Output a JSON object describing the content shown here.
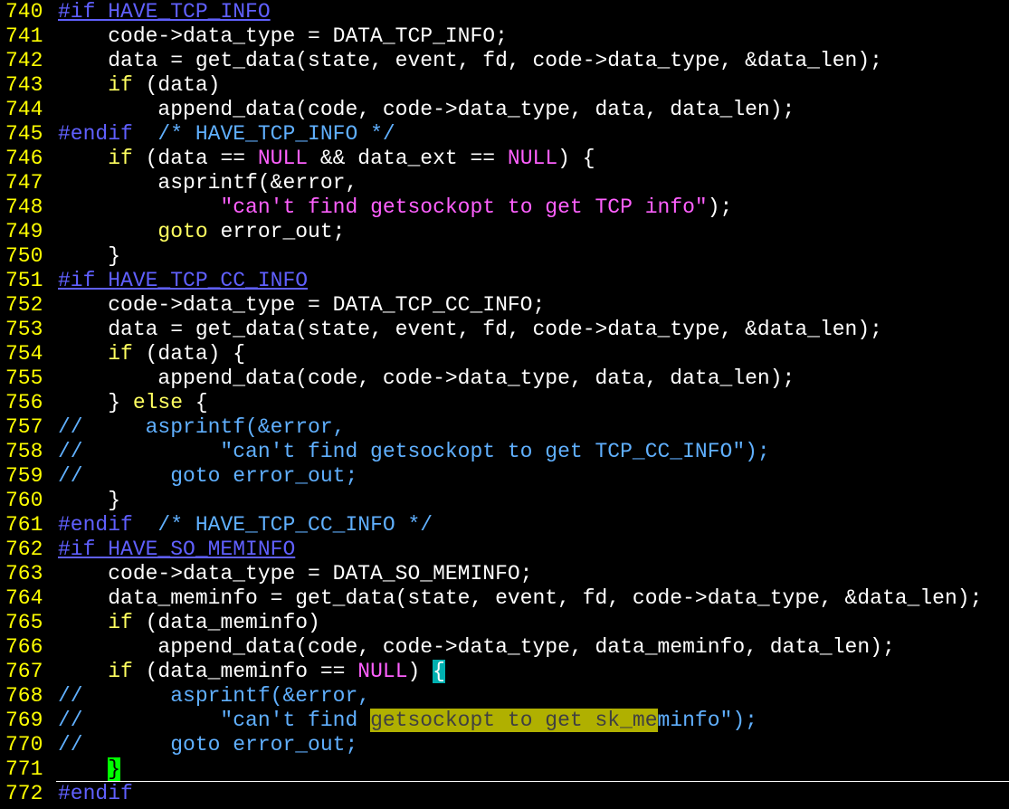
{
  "colors": {
    "background": "#000000",
    "line_number": "#ffff00",
    "preprocessor": "#6060ff",
    "keyword": "#ffff60",
    "string": "#ff60ff",
    "comment": "#60b0ff",
    "search_highlight": "#b0b000",
    "match_paren": "#00b0b0",
    "cursor": "#00ff00"
  },
  "lines": [
    {
      "n": "740",
      "tokens": [
        {
          "t": "#if HAVE_TCP_INFO",
          "c": "pre ul"
        }
      ]
    },
    {
      "n": "741",
      "tokens": [
        {
          "t": "    code->data_type = DATA_TCP_INFO;",
          "c": ""
        }
      ]
    },
    {
      "n": "742",
      "tokens": [
        {
          "t": "    data = get_data(state, event, fd, code->data_type, &data_len);",
          "c": ""
        }
      ]
    },
    {
      "n": "743",
      "tokens": [
        {
          "t": "    ",
          "c": ""
        },
        {
          "t": "if",
          "c": "kw"
        },
        {
          "t": " (data)",
          "c": ""
        }
      ]
    },
    {
      "n": "744",
      "tokens": [
        {
          "t": "        append_data(code, code->data_type, data, data_len);",
          "c": ""
        }
      ]
    },
    {
      "n": "745",
      "tokens": [
        {
          "t": "#endif",
          "c": "pre"
        },
        {
          "t": "  /* HAVE_TCP_INFO */",
          "c": "cmt"
        }
      ]
    },
    {
      "n": "746",
      "tokens": [
        {
          "t": "    ",
          "c": ""
        },
        {
          "t": "if",
          "c": "kw"
        },
        {
          "t": " (data == ",
          "c": ""
        },
        {
          "t": "NULL",
          "c": "num"
        },
        {
          "t": " && data_ext == ",
          "c": ""
        },
        {
          "t": "NULL",
          "c": "num"
        },
        {
          "t": ") {",
          "c": ""
        }
      ]
    },
    {
      "n": "747",
      "tokens": [
        {
          "t": "        asprintf(&error,",
          "c": ""
        }
      ]
    },
    {
      "n": "748",
      "tokens": [
        {
          "t": "             ",
          "c": ""
        },
        {
          "t": "\"can't find getsockopt to get TCP info\"",
          "c": "str"
        },
        {
          "t": ");",
          "c": ""
        }
      ]
    },
    {
      "n": "749",
      "tokens": [
        {
          "t": "        ",
          "c": ""
        },
        {
          "t": "goto",
          "c": "kw"
        },
        {
          "t": " error_out;",
          "c": ""
        }
      ]
    },
    {
      "n": "750",
      "tokens": [
        {
          "t": "    }",
          "c": ""
        }
      ]
    },
    {
      "n": "751",
      "tokens": [
        {
          "t": "#if HAVE_TCP_CC_INFO",
          "c": "pre ul"
        }
      ]
    },
    {
      "n": "752",
      "tokens": [
        {
          "t": "    code->data_type = DATA_TCP_CC_INFO;",
          "c": ""
        }
      ]
    },
    {
      "n": "753",
      "tokens": [
        {
          "t": "    data = get_data(state, event, fd, code->data_type, &data_len);",
          "c": ""
        }
      ]
    },
    {
      "n": "754",
      "tokens": [
        {
          "t": "    ",
          "c": ""
        },
        {
          "t": "if",
          "c": "kw"
        },
        {
          "t": " (data) {",
          "c": ""
        }
      ]
    },
    {
      "n": "755",
      "tokens": [
        {
          "t": "        append_data(code, code->data_type, data, data_len);",
          "c": ""
        }
      ]
    },
    {
      "n": "756",
      "tokens": [
        {
          "t": "    } ",
          "c": ""
        },
        {
          "t": "else",
          "c": "kw"
        },
        {
          "t": " {",
          "c": ""
        }
      ]
    },
    {
      "n": "757",
      "tokens": [
        {
          "t": "//     asprintf(&error,",
          "c": "cmt"
        }
      ]
    },
    {
      "n": "758",
      "tokens": [
        {
          "t": "//           \"can't find getsockopt to get TCP_CC_INFO\");",
          "c": "cmt"
        }
      ]
    },
    {
      "n": "759",
      "tokens": [
        {
          "t": "//       goto error_out;",
          "c": "cmt"
        }
      ]
    },
    {
      "n": "760",
      "tokens": [
        {
          "t": "    }",
          "c": ""
        }
      ]
    },
    {
      "n": "761",
      "tokens": [
        {
          "t": "#endif",
          "c": "pre"
        },
        {
          "t": "  /* HAVE_TCP_CC_INFO */",
          "c": "cmt"
        }
      ]
    },
    {
      "n": "762",
      "tokens": [
        {
          "t": "#if HAVE_SO_MEMINFO",
          "c": "pre ul"
        }
      ]
    },
    {
      "n": "763",
      "tokens": [
        {
          "t": "    code->data_type = DATA_SO_MEMINFO;",
          "c": ""
        }
      ]
    },
    {
      "n": "764",
      "tokens": [
        {
          "t": "    data_meminfo = get_data(state, event, fd, code->data_type, &data_len);",
          "c": ""
        }
      ]
    },
    {
      "n": "765",
      "tokens": [
        {
          "t": "    ",
          "c": ""
        },
        {
          "t": "if",
          "c": "kw"
        },
        {
          "t": " (data_meminfo)",
          "c": ""
        }
      ]
    },
    {
      "n": "766",
      "tokens": [
        {
          "t": "        append_data(code, code->data_type, data_meminfo, data_len);",
          "c": ""
        }
      ]
    },
    {
      "n": "767",
      "tokens": [
        {
          "t": "    ",
          "c": ""
        },
        {
          "t": "if",
          "c": "kw"
        },
        {
          "t": " (data_meminfo == ",
          "c": ""
        },
        {
          "t": "NULL",
          "c": "num"
        },
        {
          "t": ") ",
          "c": ""
        },
        {
          "t": "{",
          "c": "match"
        }
      ]
    },
    {
      "n": "768",
      "tokens": [
        {
          "t": "//       asprintf(&error,",
          "c": "cmt"
        }
      ]
    },
    {
      "n": "769",
      "tokens": [
        {
          "t": "//           \"can't find ",
          "c": "cmt"
        },
        {
          "t": "getsockopt to get sk_me",
          "c": "search"
        },
        {
          "t": "minfo\");",
          "c": "cmt"
        }
      ]
    },
    {
      "n": "770",
      "tokens": [
        {
          "t": "//       goto error_out;",
          "c": "cmt"
        }
      ]
    },
    {
      "n": "771",
      "tokens": [
        {
          "t": "    ",
          "c": ""
        },
        {
          "t": "}",
          "c": "cursor"
        }
      ],
      "cursorline": true
    },
    {
      "n": "772",
      "tokens": [
        {
          "t": "#endif",
          "c": "pre"
        }
      ]
    }
  ]
}
